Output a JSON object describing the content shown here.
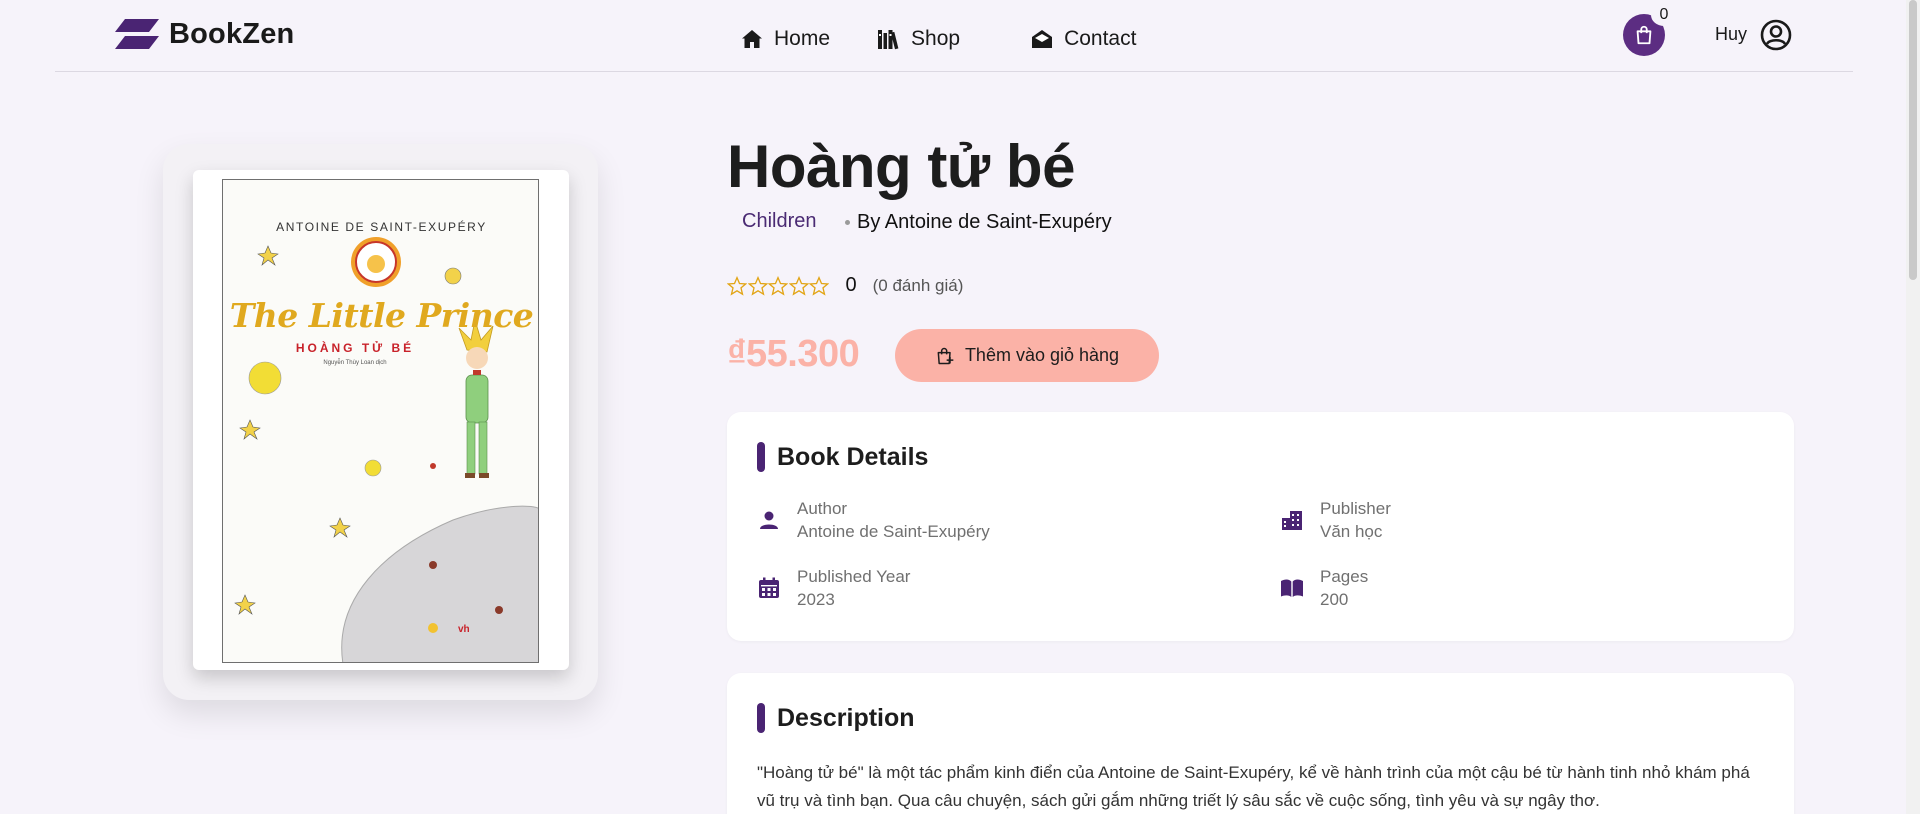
{
  "header": {
    "logo_text": "BookZen",
    "nav": [
      {
        "label": "Home",
        "icon": "home-icon"
      },
      {
        "label": "Shop",
        "icon": "books-icon"
      },
      {
        "label": "Contact",
        "icon": "mail-open-icon"
      }
    ],
    "cart_count": "0",
    "user_name": "Huy",
    "accent_color": "#5c2d82"
  },
  "cover": {
    "author": "ANTOINE DE SAINT-EXUPÉRY",
    "title": "The Little Prince",
    "subtitle": "HOÀNG TỬ BÉ",
    "translator": "Nguyễn Thùy Loan dịch"
  },
  "book": {
    "title": "Hoàng tử bé",
    "category": "Children",
    "author_line": "By Antoine de Saint-Exupéry",
    "rating_value": "0",
    "rating_count": "(0 đánh giá)",
    "rating_stars": 0,
    "price": "₫55.300",
    "add_to_cart_label": "Thêm vào giỏ hàng",
    "price_color": "#fbb2a7"
  },
  "details": {
    "heading": "Book Details",
    "author_label": "Author",
    "author_value": "Antoine de Saint-Exupéry",
    "publisher_label": "Publisher",
    "publisher_value": "Văn học",
    "year_label": "Published Year",
    "year_value": "2023",
    "pages_label": "Pages",
    "pages_value": "200"
  },
  "description": {
    "heading": "Description",
    "text": "\"Hoàng tử bé\" là một tác phẩm kinh điển của Antoine de Saint-Exupéry, kể về hành trình của một cậu bé từ hành tinh nhỏ khám phá vũ trụ và tình bạn. Qua câu chuyện, sách gửi gắm những triết lý sâu sắc về cuộc sống, tình yêu và sự ngây thơ."
  }
}
